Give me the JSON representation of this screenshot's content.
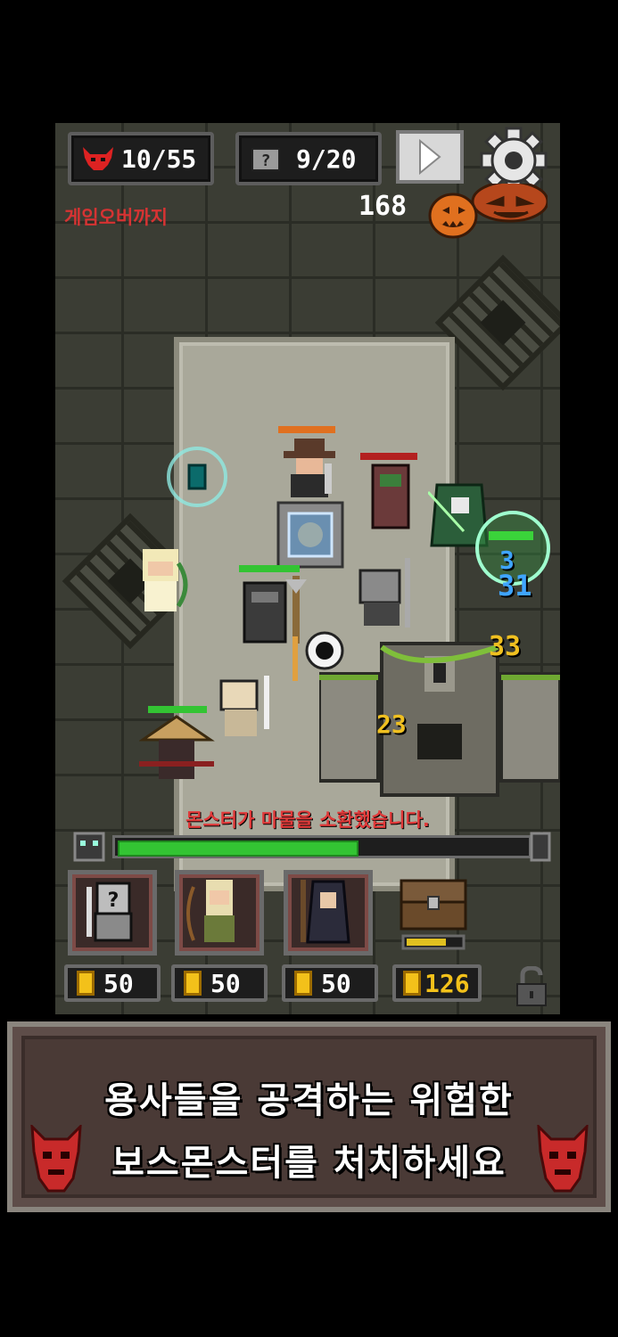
{
  "hud": {
    "lives": "10/55",
    "cards": "9/20",
    "gold": "168",
    "gameover_label": "게임오버까지"
  },
  "battle": {
    "notice": "몬스터가 마물을 소환했습니다.",
    "damage_numbers": [
      "3",
      "31",
      "33",
      "23"
    ],
    "wave_progress": 0.58
  },
  "shop": {
    "hero_slots": [
      {
        "name": "knight",
        "cost": "50"
      },
      {
        "name": "elf-archer",
        "cost": "50"
      },
      {
        "name": "dark-mage",
        "cost": "50"
      }
    ],
    "chest_cost": "126"
  },
  "banner": {
    "line1": "용사들을 공격하는 위험한",
    "line2": "보스몬스터를 처치하세요"
  },
  "colors": {
    "accent_red": "#d63333",
    "hp_green": "#33c433",
    "gold": "#f3c11a"
  }
}
